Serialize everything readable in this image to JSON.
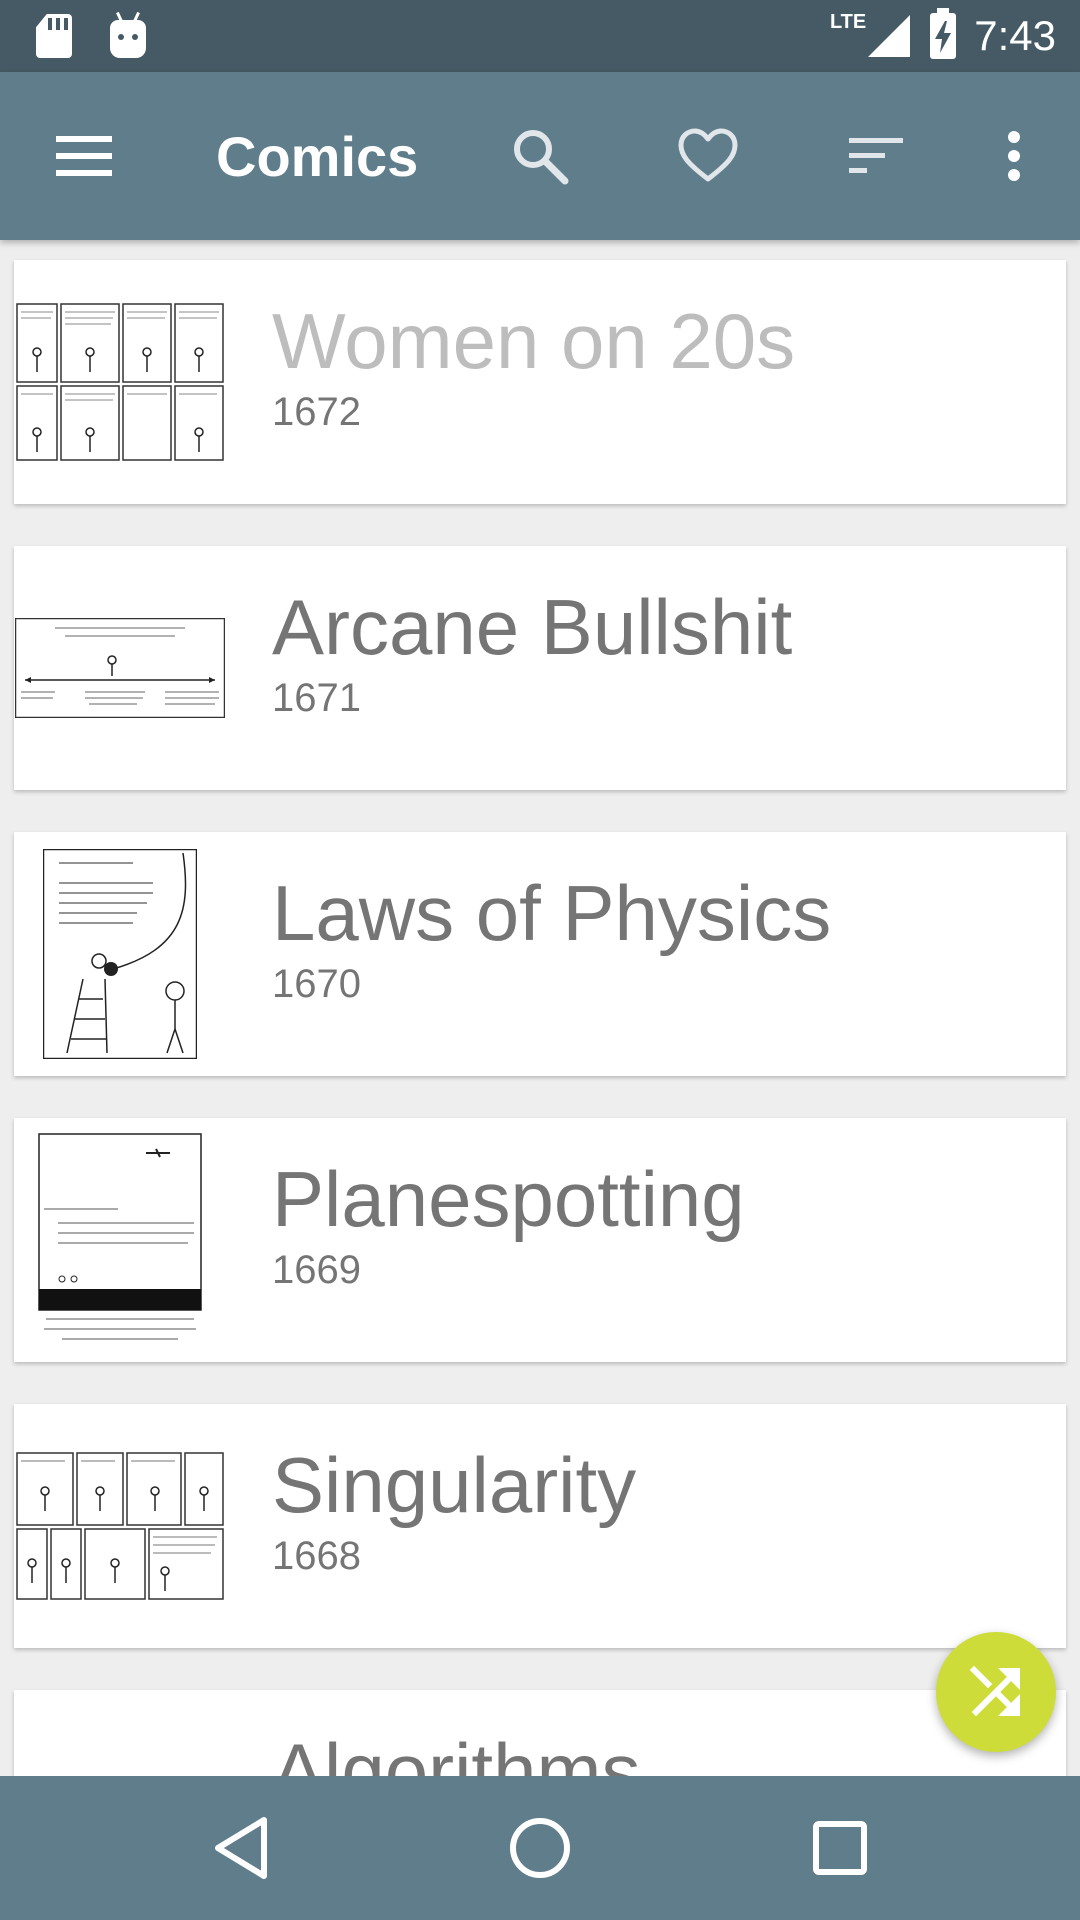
{
  "status_bar": {
    "network": "LTE",
    "time": "7:43",
    "icons": [
      "sd-card-icon",
      "android-debug-icon",
      "signal-icon",
      "battery-charging-icon"
    ]
  },
  "app_bar": {
    "title": "Comics",
    "actions": [
      "menu-icon",
      "search-icon",
      "heart-icon",
      "sort-icon",
      "more-vert-icon"
    ]
  },
  "comics": [
    {
      "title": "Women on 20s",
      "number": "1672",
      "read": true
    },
    {
      "title": "Arcane Bullshit",
      "number": "1671",
      "read": false
    },
    {
      "title": "Laws of Physics",
      "number": "1670",
      "read": false
    },
    {
      "title": "Planespotting",
      "number": "1669",
      "read": false
    },
    {
      "title": "Singularity",
      "number": "1668",
      "read": false
    },
    {
      "title": "Algorithms",
      "number": "",
      "read": false
    }
  ],
  "fab": {
    "icon": "shuffle-icon",
    "color": "#cddc39"
  },
  "nav_bar": {
    "buttons": [
      "back-icon",
      "home-icon",
      "recents-icon"
    ]
  },
  "colors": {
    "status_bar": "#455a64",
    "app_bar": "#607d8b",
    "accent": "#cddc39",
    "background": "#eeeeee"
  }
}
